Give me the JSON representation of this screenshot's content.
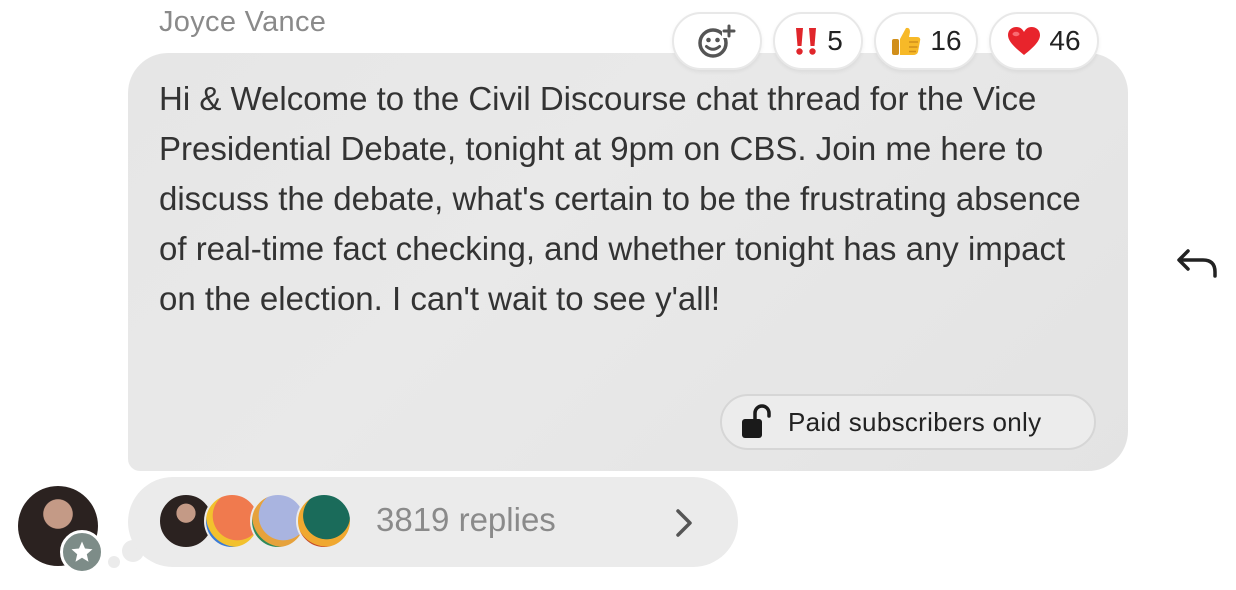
{
  "post": {
    "author": "Joyce Vance",
    "message": "Hi & Welcome to the Civil Discourse chat thread for the Vice Presidential Debate, tonight at 9pm on CBS. Join me here to discuss the debate, what's certain to be the frustrating absence of real-time fact checking, and whether tonight has any impact on the election. I can't wait to see y'all!",
    "badge_label": "Paid subscribers only"
  },
  "reactions": [
    {
      "icon": "add-reaction-icon",
      "count": ""
    },
    {
      "icon": "double-exclamation-icon",
      "count": "5"
    },
    {
      "icon": "thumbs-up-icon",
      "count": "16"
    },
    {
      "icon": "red-heart-icon",
      "count": "46"
    }
  ],
  "thread": {
    "replies_label": "3819 replies"
  },
  "colors": {
    "bubble": "#e6e6e6",
    "text": "#333333",
    "muted": "#8a8a8a",
    "exclaim": "#e0262b",
    "heart": "#e8242c"
  }
}
